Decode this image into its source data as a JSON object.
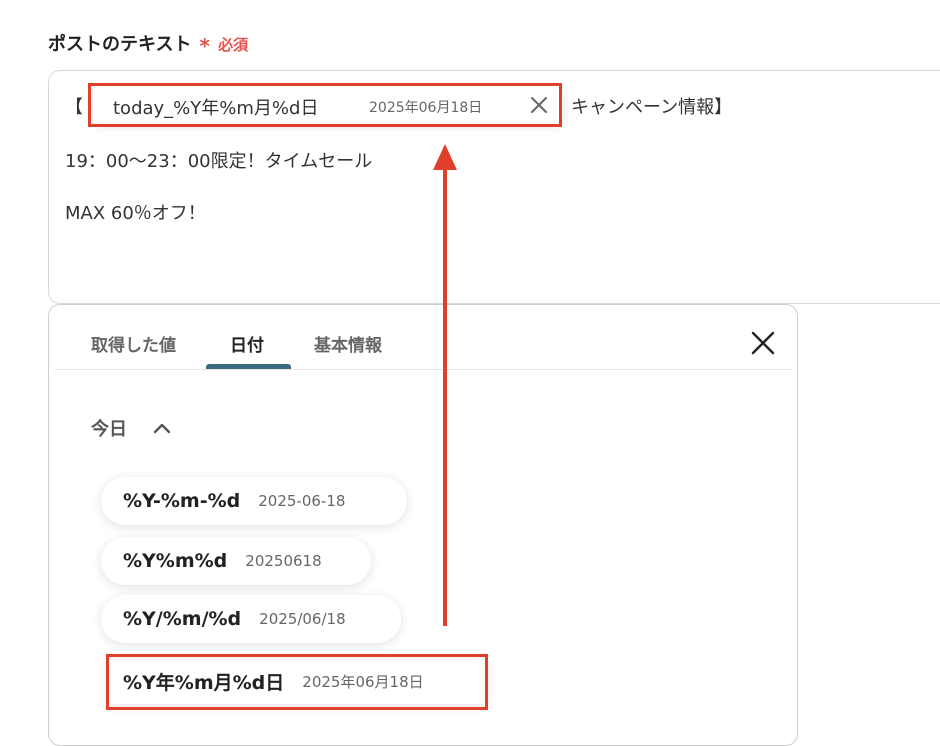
{
  "field": {
    "label": "ポストのテキスト",
    "required_mark": "*",
    "required_text": "必須"
  },
  "post_text": {
    "bracket_open": "【",
    "token": {
      "name": "today_%Y年%m月%d日",
      "value": "2025年06月18日"
    },
    "line1_rest": "キャンペーン情報】",
    "line2": "19：00〜23：00限定！タイムセール",
    "line3": "MAX 60％オフ！"
  },
  "panel": {
    "tabs": [
      {
        "label": "取得した値"
      },
      {
        "label": "日付"
      },
      {
        "label": "基本情報"
      }
    ],
    "active_tab": "日付",
    "section": {
      "title": "今日",
      "expanded": true
    },
    "options": [
      {
        "format": "%Y-%m-%d",
        "value": "2025-06-18"
      },
      {
        "format": "%Y%m%d",
        "value": "20250618"
      },
      {
        "format": "%Y/%m/%d",
        "value": "2025/06/18"
      },
      {
        "format": "%Y年%m月%d日",
        "value": "2025年06月18日"
      }
    ]
  },
  "colors": {
    "highlight": "#e0402a",
    "required": "#e5534b",
    "tab_underline": "#3a6a80"
  }
}
